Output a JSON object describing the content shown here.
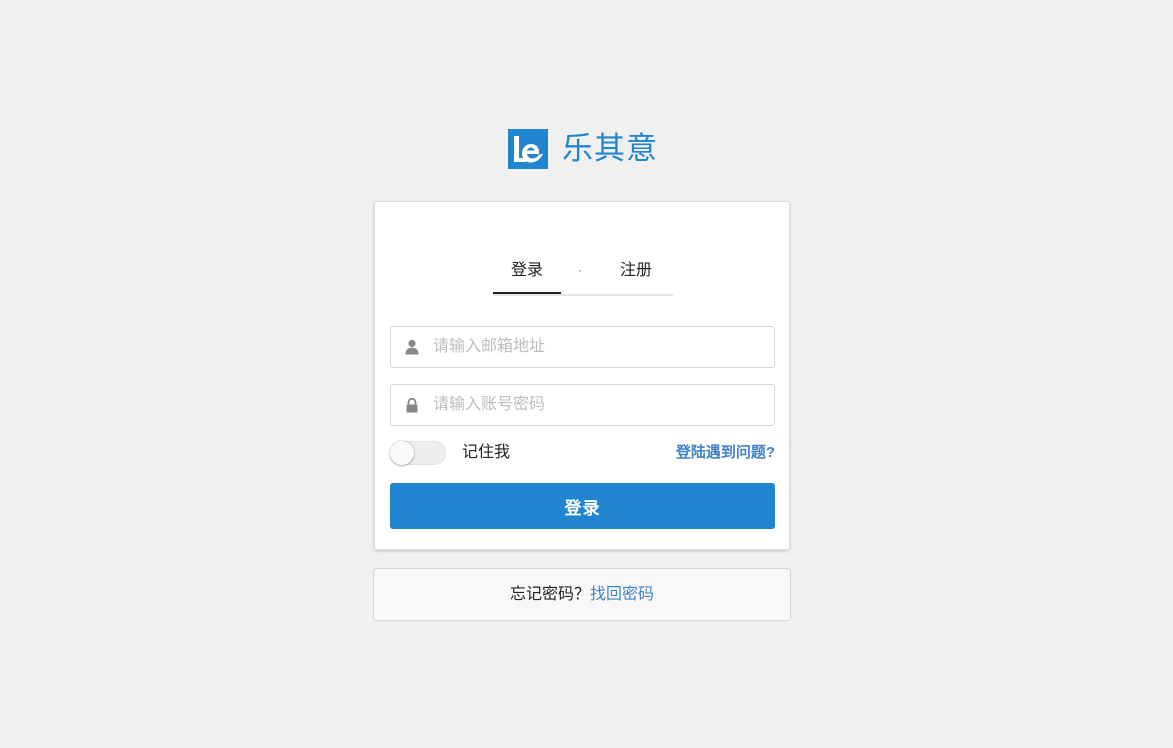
{
  "brand": {
    "logo_icon": "le-logo-icon",
    "name": "乐其意",
    "color": "#2185d0"
  },
  "tabs": [
    {
      "label": "登录",
      "active": true
    },
    {
      "label": "注册",
      "active": false
    }
  ],
  "tab_separator": "·",
  "form": {
    "email": {
      "placeholder": "请输入邮箱地址",
      "value": "",
      "icon": "user-icon"
    },
    "password": {
      "placeholder": "请输入账号密码",
      "value": "",
      "icon": "lock-icon"
    },
    "remember": {
      "label": "记住我",
      "checked": false
    },
    "trouble_link": "登陆遇到问题?",
    "submit_label": "登录"
  },
  "forgot": {
    "text": "忘记密码？",
    "link": "找回密码"
  },
  "colors": {
    "primary": "#2185d0",
    "link": "#4183c4",
    "background": "#f0f0f0"
  }
}
